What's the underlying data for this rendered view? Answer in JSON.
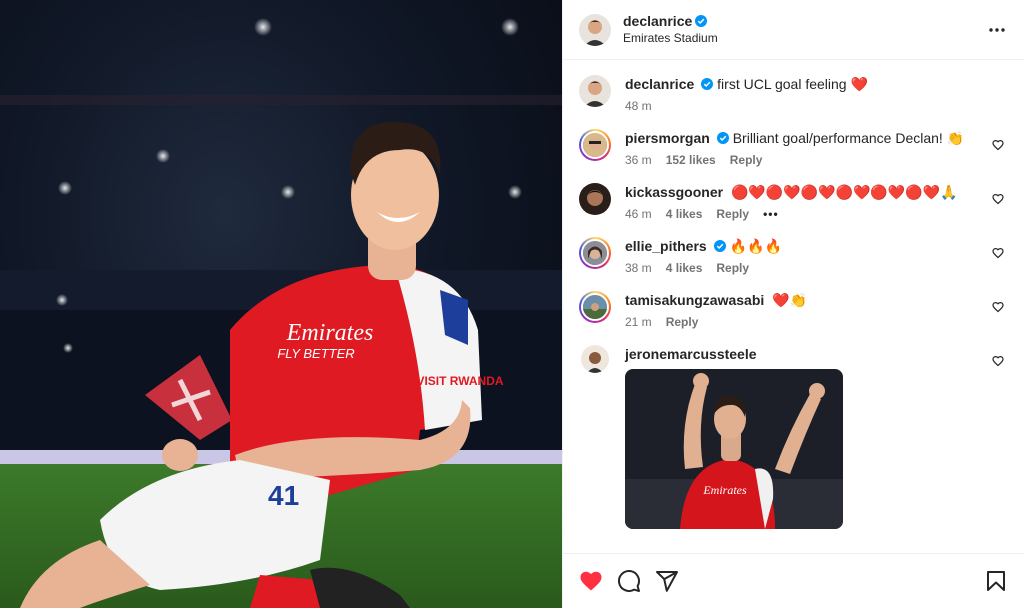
{
  "post": {
    "author": "declanrice",
    "location": "Emirates Stadium",
    "caption": {
      "user": "declanrice",
      "text": "first UCL goal feeling ❤️",
      "time": "48 m"
    },
    "photo": {
      "sponsor_line1": "Emirates",
      "sponsor_line2": "FLY BETTER",
      "shorts_number": "41",
      "sleeve_text": "VISIT RWANDA"
    }
  },
  "comments": [
    {
      "user": "piersmorgan",
      "verified": true,
      "text": "Brilliant goal/performance Declan! 👏",
      "time": "36 m",
      "likes": "152 likes",
      "reply": "Reply"
    },
    {
      "user": "kickassgooner",
      "verified": false,
      "text": "🔴❤️🔴❤️🔴❤️🔴❤️🔴❤️🔴❤️🙏",
      "time": "46 m",
      "likes": "4 likes",
      "reply": "Reply",
      "more": "•••"
    },
    {
      "user": "ellie_pithers",
      "verified": true,
      "text": "🔥🔥🔥",
      "time": "38 m",
      "likes": "4 likes",
      "reply": "Reply"
    },
    {
      "user": "tamisakungzawasabi",
      "verified": false,
      "text": "❤️👏",
      "time": "21 m",
      "reply": "Reply"
    },
    {
      "user": "jeronemarcussteele",
      "verified": false,
      "text": ""
    }
  ],
  "gif": {
    "shirt_text": "Emirates"
  },
  "icons": {
    "more": "more-horizontal-icon",
    "like": "heart-filled-icon",
    "comment": "comment-icon",
    "share": "share-icon",
    "save": "bookmark-icon"
  },
  "colors": {
    "like": "#ff3040",
    "verified": "#0095f6",
    "arsenal_red": "#db0007"
  }
}
